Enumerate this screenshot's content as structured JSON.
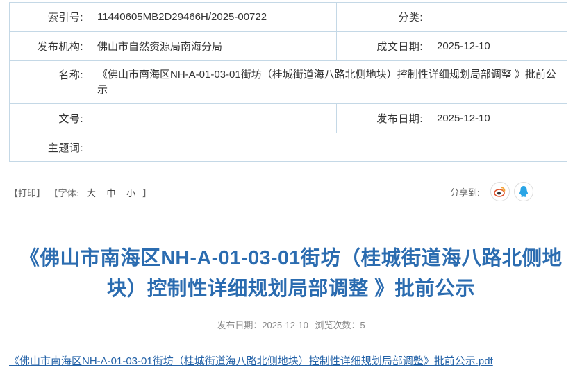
{
  "meta": {
    "index_label": "索引号:",
    "index_value": "11440605MB2D29466H/2025-00722",
    "category_label": "分类:",
    "category_value": "",
    "issuer_label": "发布机构:",
    "issuer_value": "佛山市自然资源局南海分局",
    "written_date_label": "成文日期:",
    "written_date_value": "2025-12-10",
    "name_label": "名称:",
    "name_value": "《佛山市南海区NH-A-01-03-01街坊（桂城街道海八路北侧地块）控制性详细规划局部调整 》批前公示",
    "doc_no_label": "文号:",
    "doc_no_value": "",
    "publish_date_label": "发布日期:",
    "publish_date_value": "2025-12-10",
    "subject_label": "主题词:",
    "subject_value": ""
  },
  "tools": {
    "print": "【打印】",
    "font_label": "【字体:",
    "font_large": "大",
    "font_medium": "中",
    "font_small": "小",
    "font_close": "】"
  },
  "share": {
    "label": "分享到:",
    "weibo_color": "#e0532f",
    "qq_color": "#2aa5e6"
  },
  "article": {
    "title": "《佛山市南海区NH-A-01-03-01街坊（桂城街道海八路北侧地块）控制性详细规划局部调整 》批前公示",
    "publish_label": "发布日期：2025-12-10",
    "views_label": "浏览次数：5"
  },
  "attachment": {
    "text": "《佛山市南海区NH-A-01-03-01街坊（桂城街道海八路北侧地块）控制性详细规划局部调整》批前公示.pdf"
  }
}
